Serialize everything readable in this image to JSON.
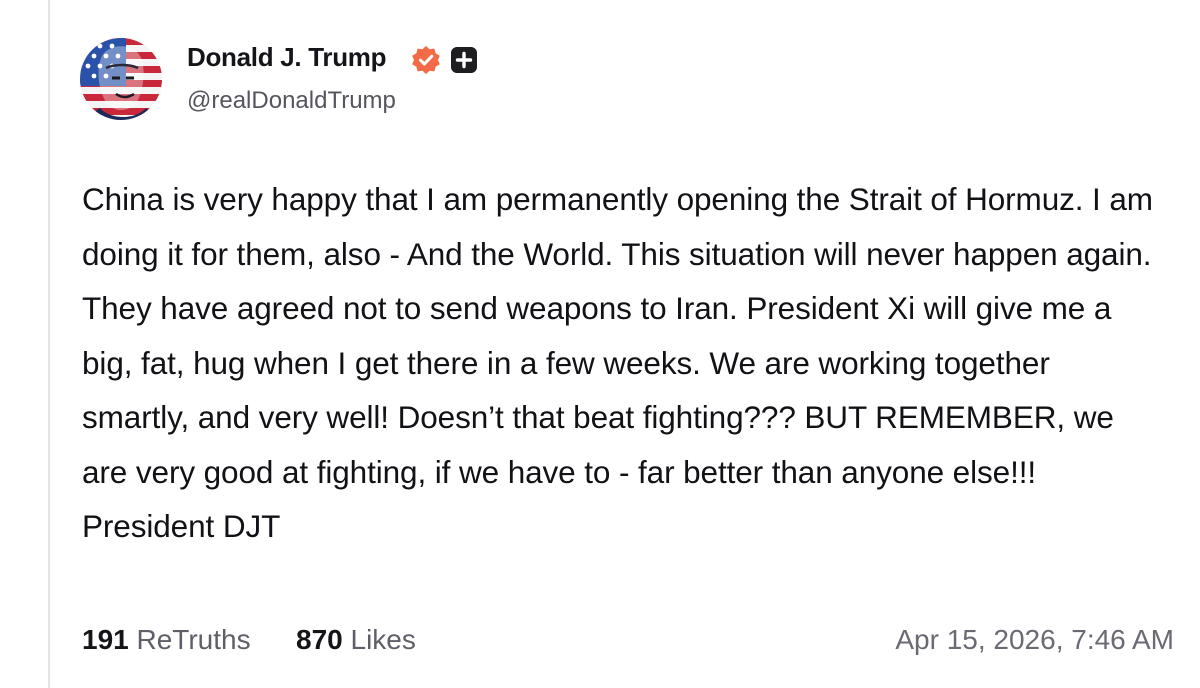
{
  "post": {
    "author": {
      "display_name": "Donald J. Trump",
      "handle": "@realDonaldTrump",
      "verified_badge_icon": "verified-check-icon",
      "plus_badge_icon": "plus-square-icon",
      "avatar_icon": "profile-avatar"
    },
    "body": "China is very happy that I am permanently opening the Strait of Hormuz. I am doing it for them, also - And the World. This situation will never happen again. They have agreed not to send weapons to Iran. President Xi will give me a big, fat, hug when I get there in a few weeks. We are working together smartly, and very well! Doesn’t that beat fighting??? BUT REMEMBER, we are very good at fighting, if we have to - far better than anyone else!!! President DJT",
    "stats": {
      "retruths_count": "191",
      "retruths_label": "ReTruths",
      "likes_count": "870",
      "likes_label": "Likes"
    },
    "timestamp": "Apr 15, 2026, 7:46 AM"
  },
  "colors": {
    "verified_badge": "#f26b46",
    "plus_badge": "#1d1d22",
    "text_primary": "#111116",
    "text_secondary": "#55555f"
  }
}
